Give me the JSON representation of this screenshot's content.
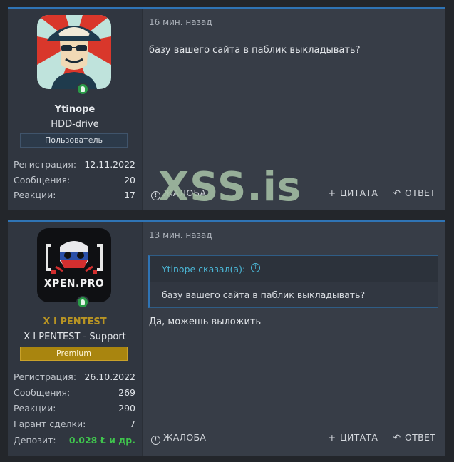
{
  "posts": [
    {
      "user": {
        "name": "Ytinope",
        "title": "HDD-drive",
        "banner": "Пользователь",
        "stats": [
          {
            "label": "Регистрация:",
            "value": "12.11.2022"
          },
          {
            "label": "Сообщения:",
            "value": "20"
          },
          {
            "label": "Реакции:",
            "value": "17"
          }
        ]
      },
      "date": "16 мин. назад",
      "text": "базу вашего сайта в паблик выкладывать?",
      "actions": {
        "report": "ЖАЛОБА",
        "quote": "ЦИТАТА",
        "reply": "ОТВЕТ"
      }
    },
    {
      "user": {
        "name": "X I PENTEST",
        "name_color": "#b89423",
        "title": "X I PENTEST - Support",
        "banner": "Premium",
        "avatar_text": "XPEN.PRO",
        "stats": [
          {
            "label": "Регистрация:",
            "value": "26.10.2022"
          },
          {
            "label": "Сообщения:",
            "value": "269"
          },
          {
            "label": "Реакции:",
            "value": "290"
          },
          {
            "label": "Гарант сделки:",
            "value": "7"
          },
          {
            "label": "Депозит:",
            "value": "0.028 Ł и др."
          }
        ]
      },
      "date": "13 мин. назад",
      "quote": {
        "author": "Ytinope сказал(а):",
        "text": "базу вашего сайта в паблик выкладывать?"
      },
      "text": "Да, можешь выложить",
      "actions": {
        "report": "ЖАЛОБА",
        "quote": "ЦИТАТА",
        "reply": "ОТВЕТ"
      }
    }
  ],
  "watermark": "XSS.is",
  "colors": {
    "accent": "#2f74b5",
    "premium": "#a9850f",
    "online": "#2a9b48",
    "deposit": "#3fc44d"
  }
}
